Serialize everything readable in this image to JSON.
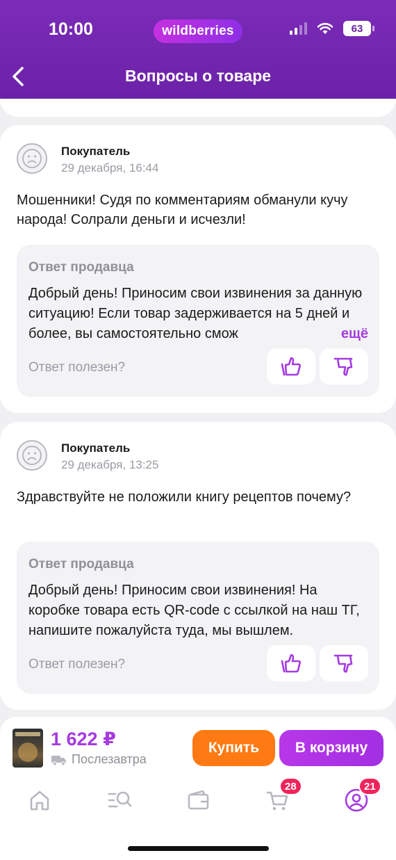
{
  "status_bar": {
    "time": "10:00",
    "brand": "wildberries",
    "battery": "63"
  },
  "header": {
    "title": "Вопросы о товаре",
    "back_icon": "chevron-left-icon"
  },
  "questions": [
    {
      "author": "Покупатель",
      "date": "29 декабря, 16:44",
      "text": "Мошенники! Судя по комментариям обманули кучу народа! Солрали деньги и исчезли!",
      "answer_label": "Ответ продавца",
      "answer_text": "Добрый день! Приносим свои извинения за данную ситуацию! Если товар задерживается на 5 дней и более, вы самостоятельно смож",
      "more_label": "ещё",
      "helpful_label": "Ответ полезен?"
    },
    {
      "author": "Покупатель",
      "date": "29 декабря, 13:25",
      "text": "Здравствуйте не положили книгу рецептов почему?",
      "answer_label": "Ответ продавца",
      "answer_text": "Добрый день! Приносим свои извинения! На коробке товара есть QR-code с ссылкой на наш ТГ, напишите пожалуйста туда, мы вышлем.",
      "helpful_label": "Ответ полезен?"
    }
  ],
  "purchase_bar": {
    "price": "1 622 ₽",
    "delivery": "Послезавтра",
    "buy_label": "Купить",
    "cart_label": "В корзину"
  },
  "tabbar": {
    "cart_badge": "28",
    "profile_badge": "21"
  },
  "colors": {
    "header": "#6c22a8",
    "accent": "#a43be0",
    "buy": "#ff7a12",
    "badge": "#f0245c"
  }
}
